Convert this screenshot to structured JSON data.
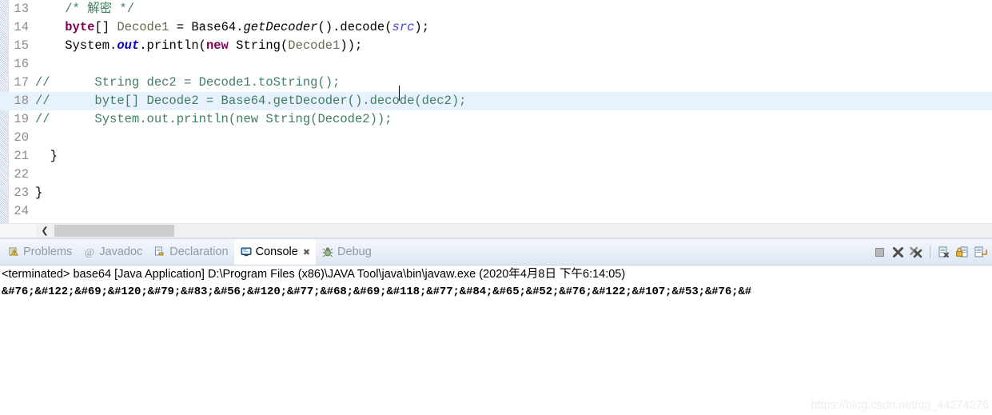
{
  "editor": {
    "lines": [
      {
        "no": "13",
        "highlight": false,
        "tokens": [
          {
            "t": "    ",
            "c": ""
          },
          {
            "t": "/* 解密 */",
            "c": "cmt"
          }
        ]
      },
      {
        "no": "14",
        "highlight": false,
        "tokens": [
          {
            "t": "    ",
            "c": ""
          },
          {
            "t": "byte",
            "c": "kw"
          },
          {
            "t": "[] ",
            "c": ""
          },
          {
            "t": "Decode1",
            "c": "fld"
          },
          {
            "t": " = Base64.",
            "c": ""
          },
          {
            "t": "getDecoder",
            "c": "staticmeth"
          },
          {
            "t": "().decode(",
            "c": ""
          },
          {
            "t": "src",
            "c": "param"
          },
          {
            "t": ");",
            "c": ""
          }
        ]
      },
      {
        "no": "15",
        "highlight": false,
        "tokens": [
          {
            "t": "    System.",
            "c": ""
          },
          {
            "t": "out",
            "c": "staticfld"
          },
          {
            "t": ".println(",
            "c": ""
          },
          {
            "t": "new",
            "c": "kw"
          },
          {
            "t": " String(",
            "c": ""
          },
          {
            "t": "Decode1",
            "c": "fld"
          },
          {
            "t": "));",
            "c": ""
          }
        ]
      },
      {
        "no": "16",
        "highlight": false,
        "tokens": [
          {
            "t": "",
            "c": ""
          }
        ]
      },
      {
        "no": "17",
        "highlight": false,
        "tokens": [
          {
            "t": "//      String dec2 = Decode1.toString();",
            "c": "cmt"
          }
        ]
      },
      {
        "no": "18",
        "highlight": true,
        "tokens": [
          {
            "t": "//      byte[] Decode2 = Base64.getDecoder().decode(dec2);",
            "c": "cmt"
          }
        ]
      },
      {
        "no": "19",
        "highlight": false,
        "tokens": [
          {
            "t": "//      System.out.println(new String(Decode2));",
            "c": "cmt"
          }
        ]
      },
      {
        "no": "20",
        "highlight": false,
        "tokens": [
          {
            "t": "",
            "c": ""
          }
        ]
      },
      {
        "no": "21",
        "highlight": false,
        "tokens": [
          {
            "t": "  }",
            "c": ""
          }
        ]
      },
      {
        "no": "22",
        "highlight": false,
        "tokens": [
          {
            "t": "",
            "c": ""
          }
        ]
      },
      {
        "no": "23",
        "highlight": false,
        "tokens": [
          {
            "t": "}",
            "c": ""
          }
        ]
      },
      {
        "no": "24",
        "highlight": false,
        "tokens": [
          {
            "t": "",
            "c": ""
          }
        ]
      }
    ],
    "hscroll": {
      "left_arrow": "❮"
    }
  },
  "panel": {
    "tabs": [
      {
        "label": "Problems",
        "icon": "problems-icon",
        "active": false,
        "closable": false
      },
      {
        "label": "Javadoc",
        "icon": "javadoc-icon",
        "active": false,
        "closable": false
      },
      {
        "label": "Declaration",
        "icon": "declaration-icon",
        "active": false,
        "closable": false
      },
      {
        "label": "Console",
        "icon": "console-icon",
        "active": true,
        "closable": true,
        "close_glyph": "✖"
      },
      {
        "label": "Debug",
        "icon": "debug-icon",
        "active": false,
        "closable": false
      }
    ],
    "toolbar": [
      {
        "name": "terminate-button",
        "title": "Terminate"
      },
      {
        "name": "remove-launch-button",
        "title": "Remove Launch"
      },
      {
        "name": "remove-all-terminated-button",
        "title": "Remove All Terminated Launches"
      },
      {
        "name": "clear-console-button",
        "title": "Clear Console"
      },
      {
        "name": "scroll-lock-button",
        "title": "Scroll Lock"
      },
      {
        "name": "display-selected-console-button",
        "title": "Display Selected Console"
      }
    ],
    "console": {
      "terminated_line": "<terminated> base64 [Java Application] D:\\Program Files (x86)\\JAVA Tool\\java\\bin\\javaw.exe (2020年4月8日 下午6:14:05)",
      "output_line": "&#76;&#122;&#69;&#120;&#79;&#83;&#56;&#120;&#77;&#68;&#69;&#118;&#77;&#84;&#65;&#52;&#76;&#122;&#107;&#53;&#76;&#"
    }
  },
  "watermark": {
    "text": "https://blog.csdn.net/qq_44274276"
  },
  "colors": {
    "comment": "#3f7f5f",
    "keyword": "#7f0055",
    "field": "#6a6a52",
    "parameter": "#4243d4",
    "static_field": "#0000c0",
    "highlight_row": "#e8f2fe"
  }
}
